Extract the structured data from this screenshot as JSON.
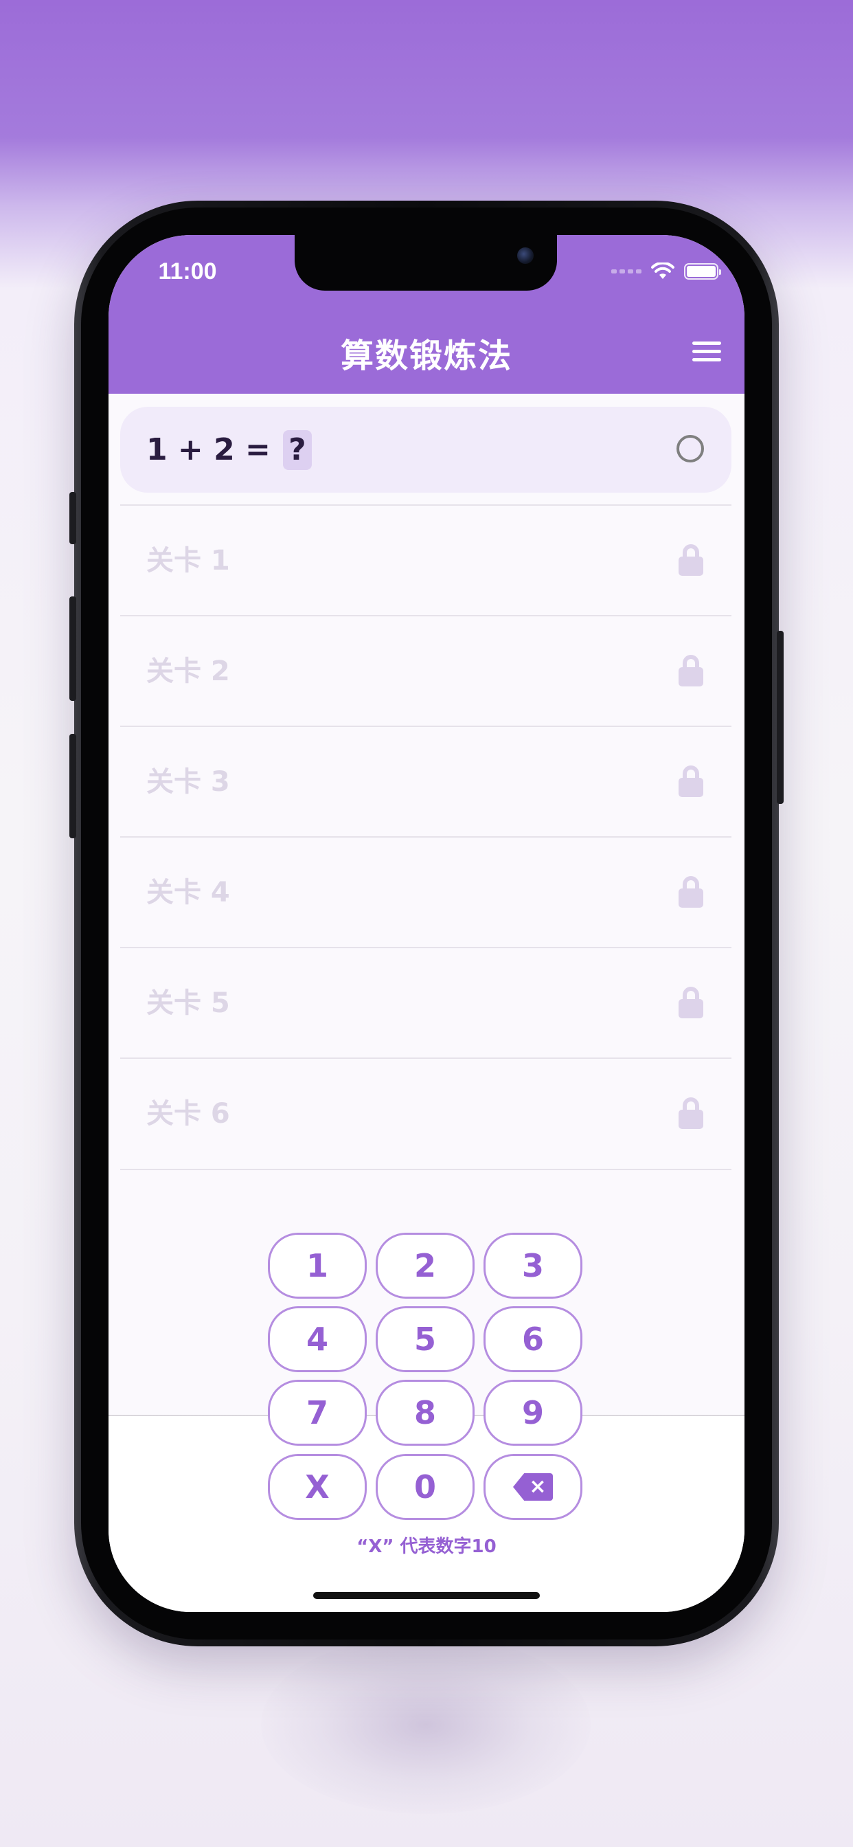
{
  "status_bar": {
    "time": "11:00"
  },
  "header": {
    "title": "算数锻炼法"
  },
  "current_question": {
    "equation": "1 + 2 =",
    "answer_placeholder": "?"
  },
  "levels": [
    {
      "label": "关卡 1"
    },
    {
      "label": "关卡 2"
    },
    {
      "label": "关卡 3"
    },
    {
      "label": "关卡 4"
    },
    {
      "label": "关卡 5"
    },
    {
      "label": "关卡 6"
    }
  ],
  "keypad": {
    "keys": [
      "1",
      "2",
      "3",
      "4",
      "5",
      "6",
      "7",
      "8",
      "9",
      "X",
      "0"
    ],
    "hint": "“X” 代表数字10"
  },
  "colors": {
    "accent": "#9b6bd8",
    "key_text": "#9560d3",
    "key_border": "#b58de0",
    "locked_text": "#ddd6e6",
    "question_bg": "#f1ebfa"
  }
}
